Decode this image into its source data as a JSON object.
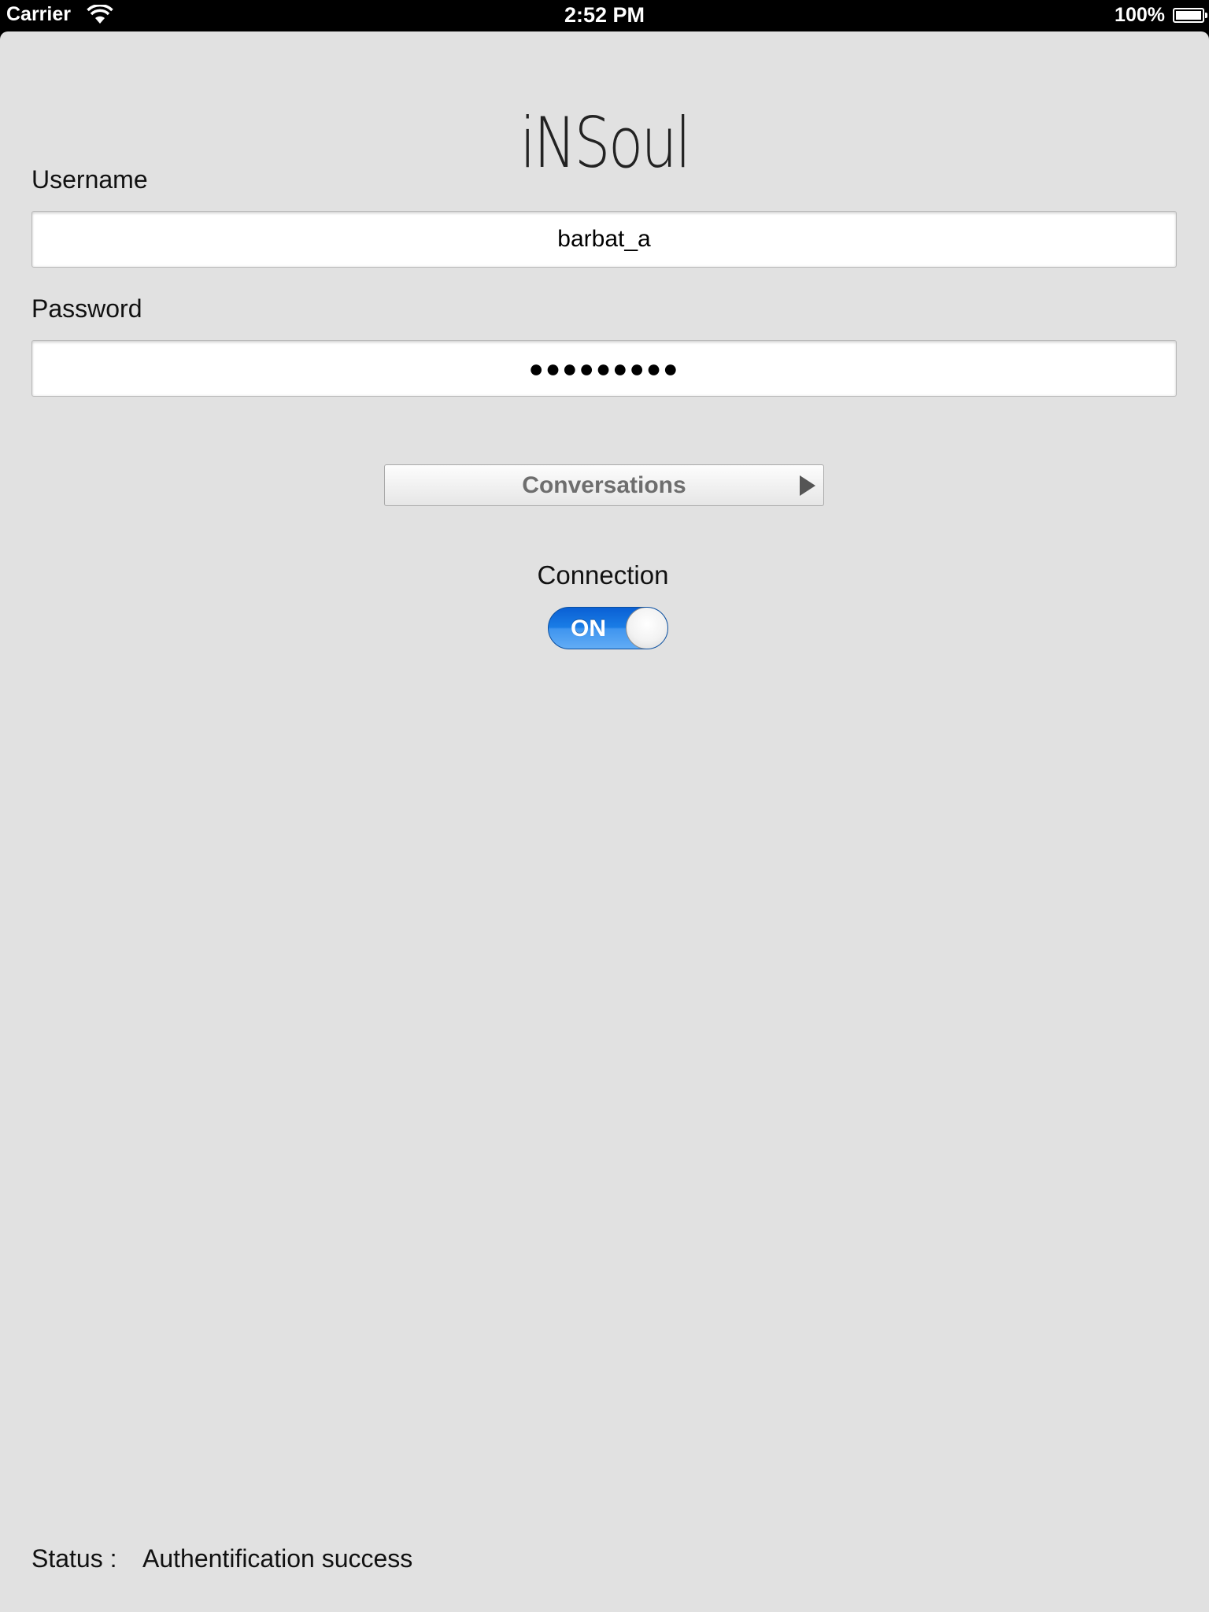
{
  "status_bar": {
    "carrier": "Carrier",
    "time": "2:52 PM",
    "battery_percent": "100%",
    "battery_level": 1.0,
    "wifi_icon": "wifi-icon",
    "battery_icon": "battery-icon"
  },
  "app": {
    "title": "iNSoul"
  },
  "form": {
    "username_label": "Username",
    "username_value": "barbat_a",
    "password_label": "Password",
    "password_masked": "●●●●●●●●●"
  },
  "conversations_button": {
    "label": "Conversations",
    "icon": "play-arrow-icon"
  },
  "connection": {
    "label": "Connection",
    "toggle_text": "ON",
    "toggle_on": true,
    "accent_color": "#1a7de6"
  },
  "status": {
    "label": "Status :",
    "value": "Authentification success"
  }
}
